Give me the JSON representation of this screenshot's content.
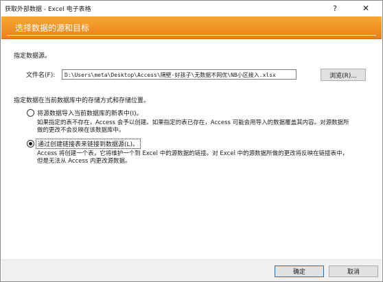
{
  "window": {
    "title": "获取外部数据 - Excel 电子表格",
    "help_symbol": "?",
    "close_symbol": "✕"
  },
  "banner": {
    "title": "选择数据的源和目标"
  },
  "source": {
    "heading": "指定数据源。",
    "file_label": "文件名(F):",
    "file_value": "D:\\Users\\meta\\Desktop\\Access\\隔壁-好孩子\\无数据不网优\\NB小区接入.xlsx",
    "browse_label": "浏览(R)..."
  },
  "storage": {
    "heading": "指定数据在当前数据库中的存储方式和存储位置。",
    "options": [
      {
        "label": "将源数据导入当前数据库的新表中(I)。",
        "selected": false,
        "description": [
          "如果指定的表不存在，Access 会予以创建。如果指定的表已存在，Access 可能会用导入的数据覆盖其内容。对源数据所",
          "做的更改不会反映在该数据库中。"
        ]
      },
      {
        "label": "通过创建链接表来链接到数据源(L)。",
        "selected": true,
        "description": [
          "Access 将创建一个表，它将维护一个到 Excel 中的源数据的链接。对 Excel 中的源数据所做的更改将反映在链接表中，",
          "但是无法从 Access 内更改源数据。"
        ]
      }
    ]
  },
  "footer": {
    "ok_label": "确定",
    "cancel_label": "取消"
  }
}
